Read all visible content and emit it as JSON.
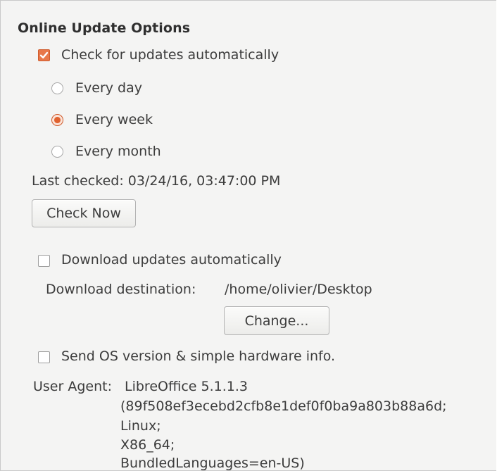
{
  "online_update": {
    "section_title": "Online Update Options",
    "check_automatically": {
      "label": "Check for updates automatically",
      "checked": true
    },
    "frequency": {
      "options": [
        "Every day",
        "Every week",
        "Every month"
      ],
      "selected": "Every week"
    },
    "last_checked": "Last checked: 03/24/16, 03:47:00 PM",
    "check_now_label": "Check Now",
    "download_automatically": {
      "label": "Download updates automatically",
      "checked": false
    },
    "download_destination_label": "Download destination:",
    "download_destination_path": "/home/olivier/Desktop",
    "change_label": "Change...",
    "send_os_info": {
      "label": "Send OS version & simple hardware info.",
      "checked": false
    },
    "user_agent_label": "User Agent:",
    "user_agent_lines": [
      "LibreOffice 5.1.1.3",
      "(89f508ef3ecebd2cfb8e1def0f0ba9a803b88a6d;",
      "Linux;",
      "X86_64;",
      "BundledLanguages=en-US)"
    ]
  },
  "colors": {
    "accent": "#e8784a",
    "panel_background": "#f4f4f3",
    "text": "#3c3c3c"
  }
}
